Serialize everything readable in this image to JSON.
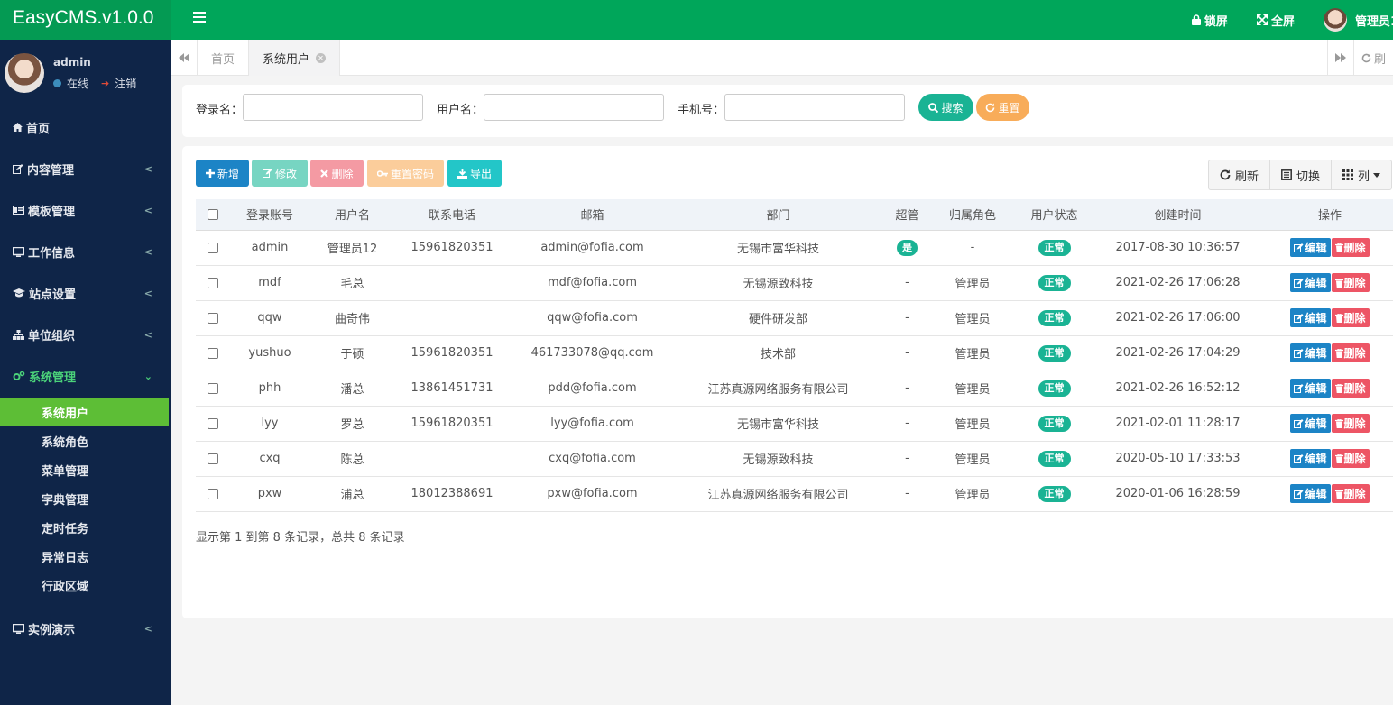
{
  "app": {
    "title": "EasyCMS.v1.0.0"
  },
  "header": {
    "lock": "锁屏",
    "fullscreen": "全屏",
    "user_name": "管理员1"
  },
  "sidebar": {
    "user": {
      "name": "admin",
      "status": "在线",
      "logout": "注销"
    },
    "items": [
      {
        "label": "首页",
        "icon": "home-icon"
      },
      {
        "label": "内容管理",
        "icon": "edit-icon"
      },
      {
        "label": "模板管理",
        "icon": "template-icon"
      },
      {
        "label": "工作信息",
        "icon": "monitor-icon"
      },
      {
        "label": "站点设置",
        "icon": "graduation-cap-icon"
      },
      {
        "label": "单位组织",
        "icon": "sitemap-icon"
      },
      {
        "label": "系统管理",
        "icon": "cogs-icon"
      },
      {
        "label": "实例演示",
        "icon": "desktop-icon"
      }
    ],
    "sub_items": [
      "系统用户",
      "系统角色",
      "菜单管理",
      "字典管理",
      "定时任务",
      "异常日志",
      "行政区域"
    ]
  },
  "tabs": {
    "home": "首页",
    "active": "系统用户",
    "refresh": "刷"
  },
  "search": {
    "login_label": "登录名：",
    "user_label": "用户名：",
    "phone_label": "手机号：",
    "search_btn": "搜索",
    "reset_btn": "重置"
  },
  "toolbar": {
    "add": "新增",
    "edit": "修改",
    "delete": "删除",
    "reset_pwd": "重置密码",
    "export": "导出",
    "refresh": "刷新",
    "toggle": "切换",
    "columns": "列"
  },
  "colors": {
    "green": "#00a65a",
    "sidebar": "#0f2548",
    "active_sub": "#5dbe36",
    "primary": "#1c84c6",
    "danger": "#ed5565",
    "teal": "#1ab394",
    "warning": "#f8ac59",
    "info": "#23c6c8"
  },
  "table": {
    "headers": [
      "登录账号",
      "用户名",
      "联系电话",
      "邮箱",
      "部门",
      "超管",
      "归属角色",
      "用户状态",
      "创建时间",
      "操作"
    ],
    "edit_label": "编辑",
    "delete_label": "删除",
    "rows": [
      {
        "account": "admin",
        "name": "管理员12",
        "phone": "15961820351",
        "email": "admin@fofia.com",
        "dept": "无锡市富华科技",
        "super": "是",
        "role": "-",
        "status": "正常",
        "created": "2017-08-30 10:36:57"
      },
      {
        "account": "mdf",
        "name": "毛总",
        "phone": "",
        "email": "mdf@fofia.com",
        "dept": "无锡源致科技",
        "super": "-",
        "role": "管理员",
        "status": "正常",
        "created": "2021-02-26 17:06:28"
      },
      {
        "account": "qqw",
        "name": "曲奇伟",
        "phone": "",
        "email": "qqw@fofia.com",
        "dept": "硬件研发部",
        "super": "-",
        "role": "管理员",
        "status": "正常",
        "created": "2021-02-26 17:06:00"
      },
      {
        "account": "yushuo",
        "name": "于硕",
        "phone": "15961820351",
        "email": "461733078@qq.com",
        "dept": "技术部",
        "super": "-",
        "role": "管理员",
        "status": "正常",
        "created": "2021-02-26 17:04:29"
      },
      {
        "account": "phh",
        "name": "潘总",
        "phone": "13861451731",
        "email": "pdd@fofia.com",
        "dept": "江苏真源网络服务有限公司",
        "super": "-",
        "role": "管理员",
        "status": "正常",
        "created": "2021-02-26 16:52:12"
      },
      {
        "account": "lyy",
        "name": "罗总",
        "phone": "15961820351",
        "email": "lyy@fofia.com",
        "dept": "无锡市富华科技",
        "super": "-",
        "role": "管理员",
        "status": "正常",
        "created": "2021-02-01 11:28:17"
      },
      {
        "account": "cxq",
        "name": "陈总",
        "phone": "",
        "email": "cxq@fofia.com",
        "dept": "无锡源致科技",
        "super": "-",
        "role": "管理员",
        "status": "正常",
        "created": "2020-05-10 17:33:53"
      },
      {
        "account": "pxw",
        "name": "浦总",
        "phone": "18012388691",
        "email": "pxw@fofia.com",
        "dept": "江苏真源网络服务有限公司",
        "super": "-",
        "role": "管理员",
        "status": "正常",
        "created": "2020-01-06 16:28:59"
      }
    ]
  },
  "pagination": {
    "info": "显示第 1 到第 8 条记录，总共 8 条记录"
  }
}
